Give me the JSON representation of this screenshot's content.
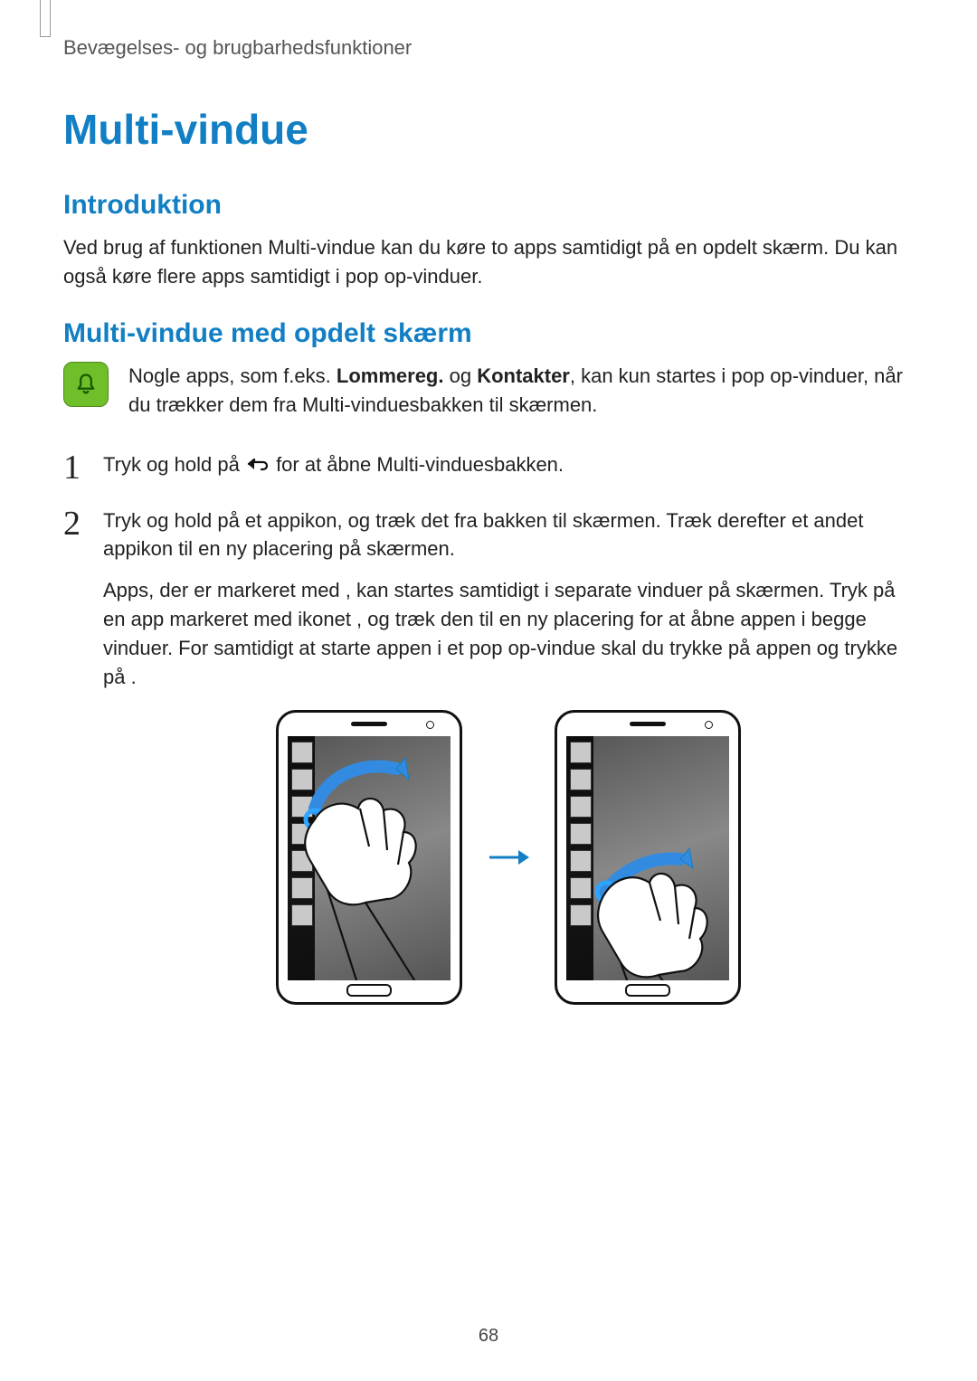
{
  "breadcrumb": "Bevægelses- og brugbarhedsfunktioner",
  "title": "Multi-vindue",
  "section_intro_heading": "Introduktion",
  "section_intro_body": "Ved brug af funktionen Multi-vindue kan du køre to apps samtidigt på en opdelt skærm. Du kan også køre flere apps samtidigt i pop op-vinduer.",
  "section_split_heading": "Multi-vindue med opdelt skærm",
  "note_pre": "Nogle apps, som f.eks. ",
  "note_bold1": "Lommereg.",
  "note_mid": " og ",
  "note_bold2": "Kontakter",
  "note_post": ", kan kun startes i pop op-vinduer, når du trækker dem fra Multi-vinduesbakken til skærmen.",
  "step1_pre": "Tryk og hold på ",
  "step1_post": " for at åbne Multi-vinduesbakken.",
  "step2_p1": "Tryk og hold på et appikon, og træk det fra bakken til skærmen. Træk derefter et andet appikon til en ny placering på skærmen.",
  "step2_p2": "Apps, der er markeret med      , kan startes samtidigt i separate vinduer på skærmen. Tryk på en app markeret med ikonet      , og træk den til en ny placering for at åbne appen i begge vinduer. For samtidigt at starte appen i et pop op-vindue skal du trykke på appen og trykke på      .",
  "page_number": "68"
}
